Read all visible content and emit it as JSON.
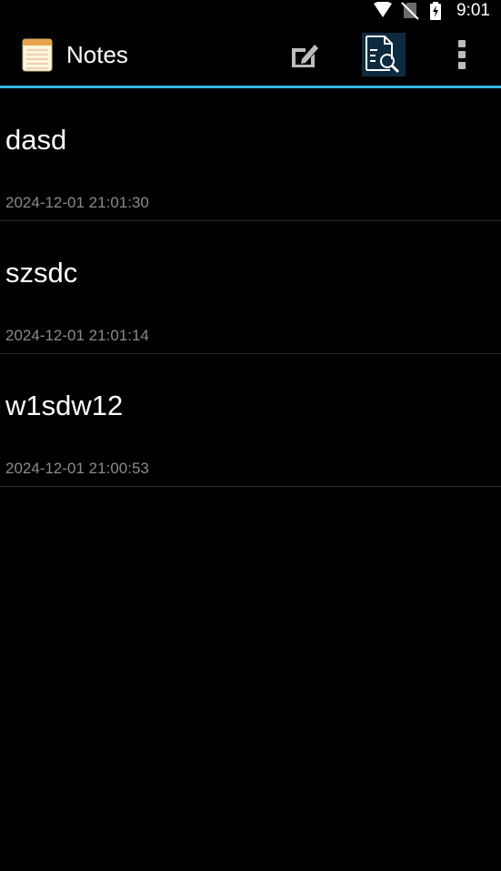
{
  "status_bar": {
    "time": "9:01",
    "icons": [
      "wifi-icon",
      "no-sim-icon",
      "battery-charging-icon"
    ]
  },
  "action_bar": {
    "title": "Notes",
    "app_icon": "notepad-icon",
    "actions": [
      "compose-icon",
      "search-document-icon",
      "overflow-menu-icon"
    ],
    "accent_color": "#33b5e5"
  },
  "notes": [
    {
      "title": "dasd",
      "date": "2024-12-01 21:01:30"
    },
    {
      "title": "szsdc",
      "date": "2024-12-01 21:01:14"
    },
    {
      "title": "w1sdw12",
      "date": "2024-12-01 21:00:53"
    }
  ]
}
